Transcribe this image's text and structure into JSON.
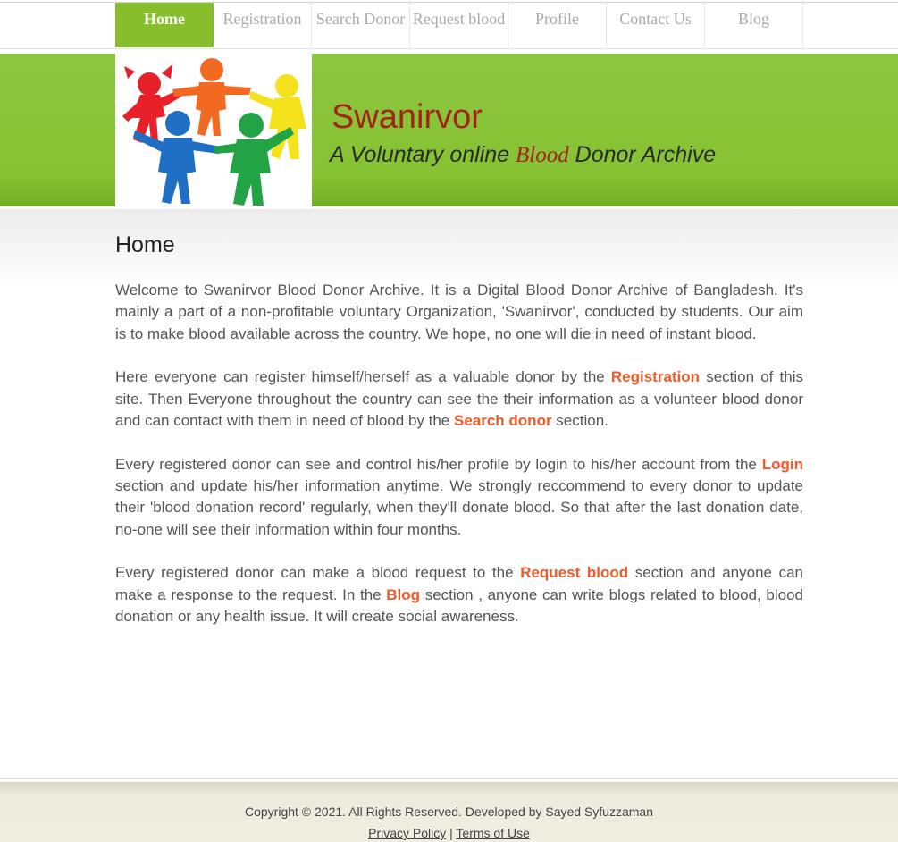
{
  "nav": {
    "items": [
      {
        "label": "Home",
        "active": true
      },
      {
        "label": "Registration",
        "active": false
      },
      {
        "label": "Search Donor",
        "active": false
      },
      {
        "label": "Request blood",
        "active": false
      },
      {
        "label": "Profile",
        "active": false
      },
      {
        "label": "Contact Us",
        "active": false
      },
      {
        "label": "Blog",
        "active": false
      }
    ]
  },
  "header": {
    "site_title": "Swanirvor",
    "tagline_before": "A Voluntary online ",
    "tagline_highlight": "Blood",
    "tagline_after": " Donor Archive"
  },
  "main": {
    "heading": "Home",
    "p1": "Welcome to Swanirvor Blood Donor Archive. It is a Digital Blood Donor Archive of Bangladesh. It's mainly a part of a non-profitable voluntary Organization, 'Swanirvor', conducted by students. Our aim is to make blood available across the country. We hope, no one will die in need of instant blood.",
    "p2": {
      "t1": "Here everyone can register himself/herself as a valuable donor by the ",
      "link1": "Registration",
      "t2": " section of this site. Then Everyone throughout the country can see the their information as a volunteer blood donor and can contact with them in need of blood by the ",
      "link2": "Search donor",
      "t3": " section."
    },
    "p3": {
      "t1": "Every registered donor can see and control his/her profile by login to his/her account from the ",
      "link1": "Login",
      "t2": " section and update his/her information anytime. We strongly reccommend to every donor to update their 'blood donation record' regularly, when they'll donate blood. So that after the last donation date, no-one will see their information within four months."
    },
    "p4": {
      "t1": "Every registered donor can make a blood request to the ",
      "link1": "Request blood",
      "t2": " section and anyone can make a response to the request. In the ",
      "link2": "Blog",
      "t3": " section , anyone can write blogs related to blood, blood donation or any health issue. It will create social awareness."
    }
  },
  "footer": {
    "copyright": "Copyright © 2021. All Rights Reserved. Developed by Sayed Syfuzzaman",
    "privacy": "Privacy Policy",
    "separator": "|",
    "terms": "Terms of Use"
  },
  "colors": {
    "nav_active": "#86bf2b",
    "header_green": "#8cc63f",
    "title_red": "#a32414",
    "link_orange": "#f05a28"
  }
}
